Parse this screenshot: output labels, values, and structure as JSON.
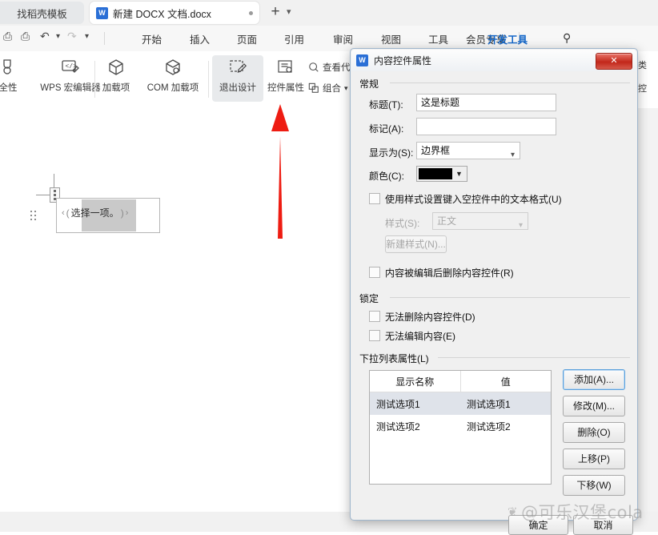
{
  "app": {
    "tabstrip": {
      "left_tab_label": "找稻壳模板",
      "doc_tab_label": "新建 DOCX 文档.docx",
      "doc_tab_icon": "wps-word-icon",
      "new_tab_label": "+",
      "tab_list_caret": "chevron-down-icon"
    },
    "quickaccess": [
      {
        "name": "save-icon",
        "glyph": "⎙"
      },
      {
        "name": "print-preview-icon",
        "glyph": "⌕"
      },
      {
        "name": "undo-icon",
        "glyph": "↶"
      },
      {
        "name": "undo-caret-icon",
        "glyph": "⌄"
      },
      {
        "name": "redo-icon",
        "glyph": "↷"
      },
      {
        "name": "more-caret-icon",
        "glyph": "⌄"
      }
    ],
    "menu": [
      {
        "label": "开始",
        "active": false
      },
      {
        "label": "插入",
        "active": false
      },
      {
        "label": "页面",
        "active": false
      },
      {
        "label": "引用",
        "active": false
      },
      {
        "label": "审阅",
        "active": false
      },
      {
        "label": "视图",
        "active": false
      },
      {
        "label": "工具",
        "active": false
      },
      {
        "label": "会员专享",
        "active": false
      },
      {
        "label": "开发工具",
        "active": true
      }
    ],
    "search_icon": "search-icon",
    "ribbon": {
      "buttons": [
        {
          "label": "全性",
          "icon": "shield-lock-icon",
          "selected": false
        },
        {
          "label": "WPS 宏编辑器",
          "icon": "code-pencil-icon",
          "selected": false
        },
        {
          "label": "加载项",
          "icon": "cube-icon",
          "selected": false
        },
        {
          "label": "COM 加载项",
          "icon": "cube-gear-icon",
          "selected": false
        },
        {
          "label": "退出设计",
          "icon": "exit-design-icon",
          "selected": true
        },
        {
          "label": "控件属性",
          "icon": "control-properties-icon",
          "selected": false
        }
      ],
      "small_items": [
        {
          "label": "查看代码",
          "icon": "view-code-icon"
        },
        {
          "label": "组合",
          "icon": "group-icon",
          "caret": "⌄"
        }
      ],
      "right_items": [
        {
          "label": "类",
          "icon": "structure-icon"
        },
        {
          "label": "控",
          "icon": "control-icon"
        }
      ]
    },
    "document": {
      "content_control_text": "选择一项。",
      "bracket_open": "‹",
      "bracket_close": "›"
    },
    "annotation": {
      "arrow_color": "#ee1c12",
      "arrow_name": "red-pointer-arrow"
    }
  },
  "dialog": {
    "title": "内容控件属性",
    "title_icon": "wps-word-icon",
    "close_label": "✕",
    "sections": {
      "general": {
        "legend": "常规",
        "title_label": "标题(T):",
        "title_value": "这是标题",
        "title_placeholder": "",
        "tag_label": "标记(A):",
        "tag_value": "",
        "tag_placeholder": "",
        "showas_label": "显示为(S):",
        "showas_value": "边界框",
        "color_label": "颜色(C):",
        "color_value": "#000000",
        "use_style_checkbox": {
          "label": "使用样式设置键入空控件中的文本格式(U)",
          "checked": false
        },
        "style_label": "样式(S):",
        "style_value": "正文",
        "new_style_button": "新建样式(N)...",
        "remove_after_edit_checkbox": {
          "label": "内容被编辑后删除内容控件(R)",
          "checked": false
        }
      },
      "lock": {
        "legend": "锁定",
        "cannot_delete_checkbox": {
          "label": "无法删除内容控件(D)",
          "checked": false
        },
        "cannot_edit_checkbox": {
          "label": "无法编辑内容(E)",
          "checked": false
        }
      },
      "dropdown": {
        "legend": "下拉列表属性(L)",
        "columns": [
          "显示名称",
          "值"
        ],
        "rows": [
          {
            "display": "测试选项1",
            "value": "测试选项1",
            "selected": true
          },
          {
            "display": "测试选项2",
            "value": "测试选项2",
            "selected": false
          }
        ],
        "buttons": [
          {
            "label": "添加(A)...",
            "name": "add-button",
            "focus": true
          },
          {
            "label": "修改(M)...",
            "name": "modify-button",
            "focus": false
          },
          {
            "label": "删除(O)",
            "name": "delete-button",
            "focus": false
          },
          {
            "label": "上移(P)",
            "name": "move-up-button",
            "focus": false
          },
          {
            "label": "下移(W)",
            "name": "move-down-button",
            "focus": false
          }
        ]
      }
    },
    "ok_label": "确定",
    "cancel_label": "取消"
  },
  "watermark": {
    "text": "@可乐汉堡cola",
    "logo": "paw-icon",
    "glyph": "❦"
  }
}
